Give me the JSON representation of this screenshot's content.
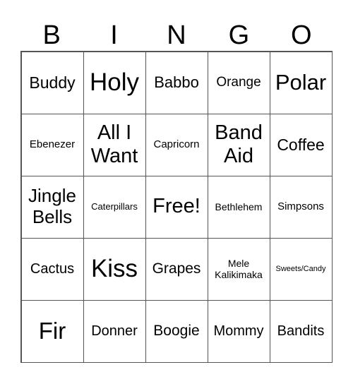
{
  "header": [
    "B",
    "I",
    "N",
    "G",
    "O"
  ],
  "cells": [
    [
      "Buddy",
      "Holy",
      "Babbo",
      "Orange",
      "Polar"
    ],
    [
      "Ebenezer",
      "All I Want",
      "Capricorn",
      "Band Aid",
      "Coffee"
    ],
    [
      "Jingle Bells",
      "Caterpillars",
      "Free!",
      "Bethlehem",
      "Simpsons"
    ],
    [
      "Cactus",
      "Kiss",
      "Grapes",
      "Mele Kalikimaka",
      "Sweets/Candy"
    ],
    [
      "Fir",
      "Donner",
      "Boogie",
      "Mommy",
      "Bandits"
    ]
  ]
}
